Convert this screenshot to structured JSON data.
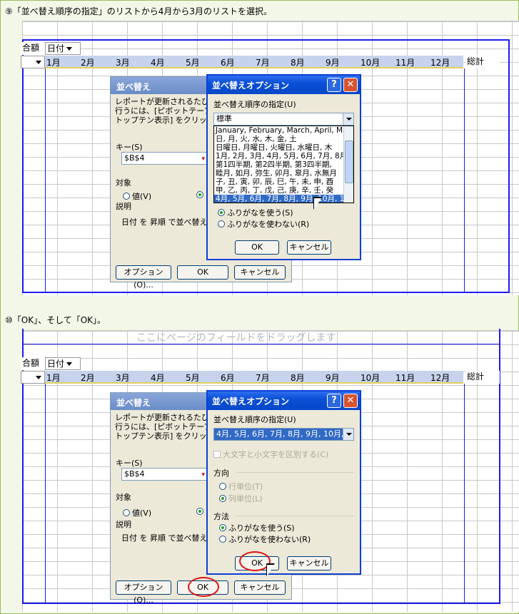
{
  "step9": {
    "caption": "⑨「並べ替え順序の指定」のリストから4月から3月のリストを選択。"
  },
  "step10": {
    "caption": "⑩「OK」、そして「OK」。"
  },
  "watermark": "ここにページのフィールドをドラッグします",
  "pivot": {
    "field_left": "合額",
    "date_field": "日付",
    "months": [
      "1月",
      "2月",
      "3月",
      "4月",
      "5月",
      "6月",
      "7月",
      "8月",
      "9月",
      "10月",
      "11月",
      "12月"
    ],
    "total": "総計"
  },
  "sort_dialog": {
    "title": "並べ替え",
    "desc_line1": "レポートが更新されるたびに",
    "desc_line2": "行うには、[ピボットテーブル]",
    "desc_line3": "トップテン表示] をクリックして",
    "key_label": "キー(S)",
    "key_value": "$B$4",
    "target_label": "対象",
    "radio_value": "値(V)",
    "desc_label": "説明",
    "desc_text": "日付 を 昇順 で並べ替え",
    "options_button": "オプション(O)...",
    "ok_button": "OK",
    "cancel_button": "キャンセル"
  },
  "options_dialog_1": {
    "title": "並べ替えオプション",
    "order_label": "並べ替え順序の指定(U)",
    "combo_value": "標準",
    "list_items": [
      "January, February, March, April, Ma",
      "日, 月, 火, 水, 木, 金, 土",
      "日曜日, 月曜日, 火曜日, 水曜日, 木",
      "1月, 2月, 3月, 4月, 5月, 6月, 7月, 8月",
      "第1四半期, 第2四半期, 第3四半期,",
      "睦月, 如月, 弥生, 卯月, 皐月, 水無月",
      "子, 丑, 寅, 卯, 辰, 巳, 午, 未, 申, 酉",
      "甲, 乙, 丙, 丁, 戊, 己, 庚, 辛, 壬, 癸",
      "4月, 5月, 6月, 7月, 8月, 9月, 10月, 1"
    ],
    "selected_index": 8,
    "radio_furigana": "ふりがなを使う(S)",
    "radio_no_furigana": "ふりがなを使わない(R)",
    "ok_button": "OK",
    "cancel_button": "キャンセル"
  },
  "options_dialog_2": {
    "title": "並べ替えオプション",
    "order_label": "並べ替え順序の指定(U)",
    "combo_value": "4月, 5月, 6月, 7月, 8月, 9月, 10月, 1",
    "case_checkbox": "大文字と小文字を区別する(C)",
    "direction_label": "方向",
    "radio_row": "行単位(T)",
    "radio_col": "列単位(L)",
    "method_label": "方法",
    "radio_furigana": "ふりがなを使う(S)",
    "radio_no_furigana": "ふりがなを使わない(R)",
    "ok_button": "OK",
    "cancel_button": "キャンセル"
  },
  "colors": {
    "highlight_circle": "#e01010",
    "pivot_border": "#1c1cf0",
    "title_bar": "#0a4fd6"
  }
}
